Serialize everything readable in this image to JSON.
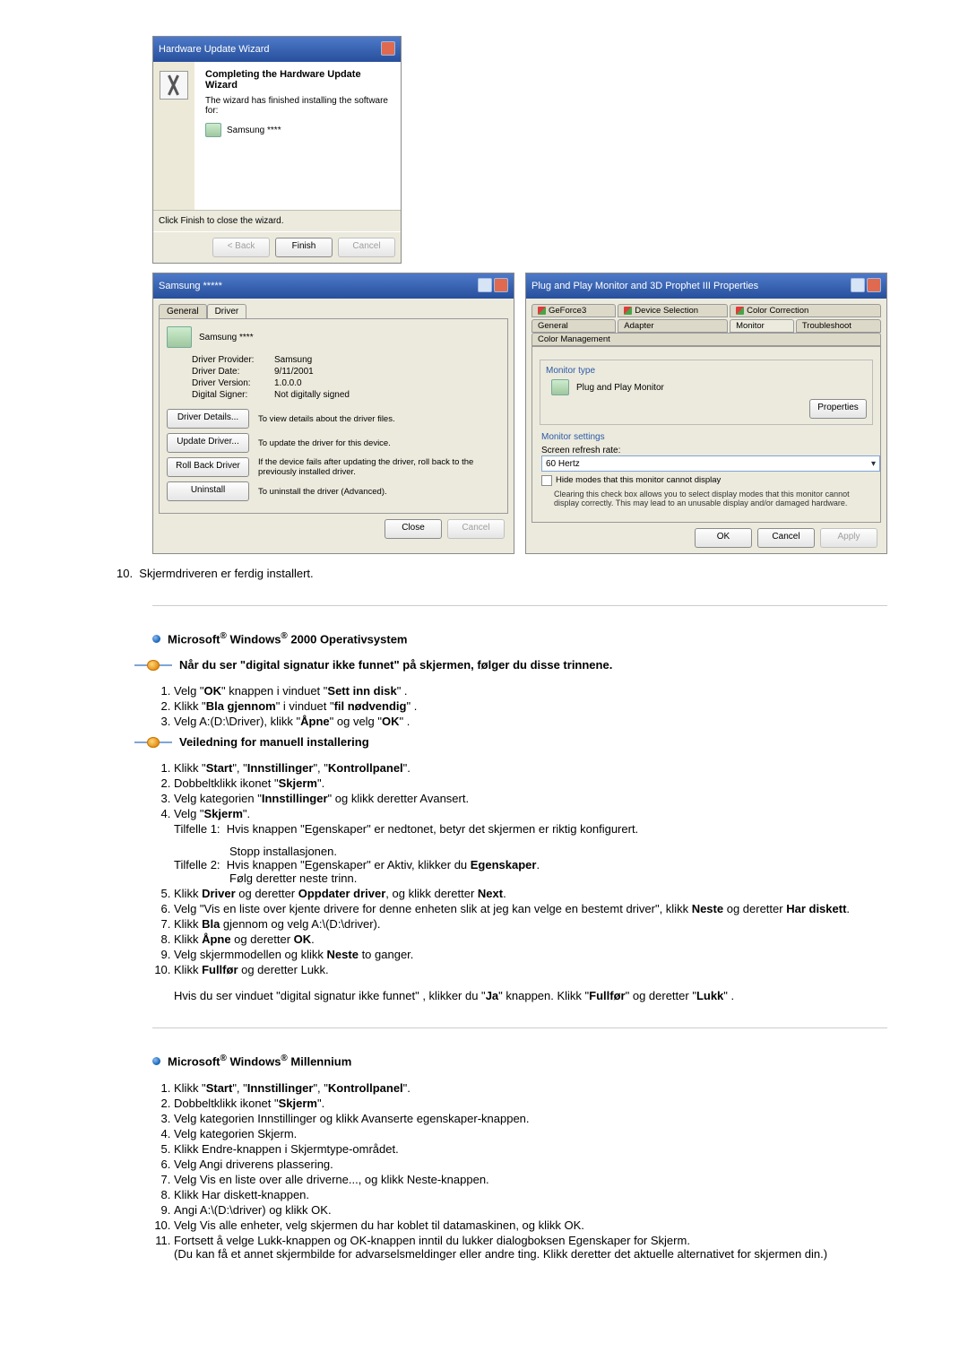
{
  "wizard": {
    "title": "Hardware Update Wizard",
    "heading": "Completing the Hardware Update Wizard",
    "subtext": "The wizard has finished installing the software for:",
    "device": "Samsung ****",
    "finish_note": "Click Finish to close the wizard.",
    "btn_back": "< Back",
    "btn_finish": "Finish",
    "btn_cancel": "Cancel"
  },
  "driver_dlg": {
    "title": "Samsung *****",
    "tab_general": "General",
    "tab_driver": "Driver",
    "device": "Samsung ****",
    "provider_label": "Driver Provider:",
    "provider_value": "Samsung",
    "date_label": "Driver Date:",
    "date_value": "9/11/2001",
    "version_label": "Driver Version:",
    "version_value": "1.0.0.0",
    "signer_label": "Digital Signer:",
    "signer_value": "Not digitally signed",
    "btn_details": "Driver Details...",
    "desc_details": "To view details about the driver files.",
    "btn_update": "Update Driver...",
    "desc_update": "To update the driver for this device.",
    "btn_rollback": "Roll Back Driver",
    "desc_rollback": "If the device fails after updating the driver, roll back to the previously installed driver.",
    "btn_uninstall": "Uninstall",
    "desc_uninstall": "To uninstall the driver (Advanced).",
    "btn_close": "Close",
    "btn_cancel": "Cancel"
  },
  "pnp_dlg": {
    "title": "Plug and Play Monitor and 3D Prophet III Properties",
    "tab_geforce": "GeForce3",
    "tab_devsel": "Device Selection",
    "tab_colorc": "Color Correction",
    "tab_general": "General",
    "tab_adapter": "Adapter",
    "tab_monitor": "Monitor",
    "tab_trouble": "Troubleshoot",
    "tab_colormgmt": "Color Management",
    "grp_type": "Monitor type",
    "pnp_name": "Plug and Play Monitor",
    "btn_props": "Properties",
    "grp_settings": "Monitor settings",
    "refresh_label": "Screen refresh rate:",
    "refresh_value": "60 Hertz",
    "chk_hide": "Hide modes that this monitor cannot display",
    "chk_note": "Clearing this check box allows you to select display modes that this monitor cannot display correctly. This may lead to an unusable display and/or damaged hardware.",
    "btn_ok": "OK",
    "btn_cancel": "Cancel",
    "btn_apply": "Apply"
  },
  "doc": {
    "step10": "Skjermdriveren er ferdig installert.",
    "sec2000": "Microsoft® Windows® 2000 Operativsystem",
    "sig_heading": "Når du ser \"digital signatur ikke funnet\" på skjermen, følger du disse trinnene.",
    "s2000_sig": [
      "Velg \"OK\" knappen i vinduet \"Sett inn disk\" .",
      "Klikk \"Bla gjennom\" i vinduet \"fil nødvendig\" .",
      "Velg A:(D:\\Driver), klikk \"Åpne\" og velg \"OK\" ."
    ],
    "manual_heading": "Veiledning for manuell installering",
    "s2000_manual_1": "Klikk \"Start\", \"Innstillinger\", \"Kontrollpanel\".",
    "s2000_manual_2": "Dobbeltklikk ikonet \"Skjerm\".",
    "s2000_manual_3": "Velg kategorien \"Innstillinger\" og klikk deretter Avansert.",
    "s2000_manual_4": "Velg \"Skjerm\".",
    "s2000_case1_label": "Tilfelle 1:",
    "s2000_case1_text": "Hvis knappen \"Egenskaper\" er nedtonet, betyr det skjermen er riktig konfigurert.",
    "s2000_case1_stop": "Stopp installasjonen.",
    "s2000_case2_label": "Tilfelle 2:",
    "s2000_case2_text": "Hvis knappen \"Egenskaper\" er Aktiv, klikker du Egenskaper.",
    "s2000_case2_next": "Følg deretter neste trinn.",
    "s2000_manual_5": "Klikk Driver og deretter Oppdater driver, og klikk deretter Next.",
    "s2000_manual_6": "Velg \"Vis en liste over kjente drivere for denne enheten slik at jeg kan velge en bestemt driver\", klikk Neste og deretter Har diskett.",
    "s2000_manual_7": "Klikk Bla gjennom og velg A:\\(D:\\driver).",
    "s2000_manual_8": "Klikk Åpne og deretter OK.",
    "s2000_manual_9": "Velg skjermmodellen og klikk Neste to ganger.",
    "s2000_manual_10": "Klikk Fullfør og deretter Lukk.",
    "s2000_note": "Hvis du ser vinduet \"digital signatur ikke funnet\" , klikker du \"Ja\" knappen. Klikk \"Fullfør\" og deretter \"Lukk\" .",
    "secME": "Microsoft® Windows® Millennium",
    "sME": [
      "Klikk \"Start\", \"Innstillinger\", \"Kontrollpanel\".",
      "Dobbeltklikk ikonet \"Skjerm\".",
      "Velg kategorien Innstillinger og klikk Avanserte egenskaper-knappen.",
      "Velg kategorien Skjerm.",
      "Klikk Endre-knappen i Skjermtype-området.",
      "Velg Angi driverens plassering.",
      "Velg Vis en liste over alle driverne..., og klikk Neste-knappen.",
      "Klikk Har diskett-knappen.",
      "Angi A:\\(D:\\driver) og klikk OK.",
      "Velg Vis alle enheter, velg skjermen du har koblet til datamaskinen, og klikk OK.",
      "Fortsett å velge Lukk-knappen og OK-knappen inntil du lukker dialogboksen Egenskaper for Skjerm."
    ],
    "sME_note": "(Du kan få et annet skjermbilde for advarselsmeldinger eller andre ting. Klikk deretter det aktuelle alternativet for skjermen din.)"
  }
}
